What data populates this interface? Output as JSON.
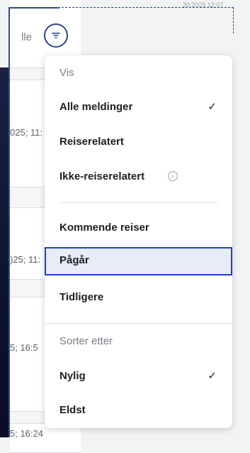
{
  "background": {
    "header_text": "lle",
    "top_timestamp": "20.2025 12:07",
    "rows": [
      {
        "timestamp": "025; 11:"
      },
      {
        "timestamp": ")25; 11:"
      },
      {
        "timestamp": "5; 16:5"
      },
      {
        "timestamp": "5; 16:24"
      }
    ]
  },
  "filter_button": {
    "icon": "filter-icon"
  },
  "menu": {
    "view_section_label": "Vis",
    "view_items": [
      {
        "label": "Alle meldinger",
        "checked": true
      },
      {
        "label": "Reiserelatert",
        "checked": false
      },
      {
        "label": "Ikke-reiserelatert",
        "checked": false,
        "info": "i"
      }
    ],
    "status_items": [
      {
        "label": "Kommende reiser"
      },
      {
        "label": "Pågår",
        "selected": true
      },
      {
        "label": "Tidligere"
      }
    ],
    "sort_section_label": "Sorter etter",
    "sort_items": [
      {
        "label": "Nylig",
        "checked": true
      },
      {
        "label": "Eldst",
        "checked": false
      }
    ],
    "check_glyph": "✓"
  },
  "colors": {
    "accent": "#1f3fd1",
    "focus_outline": "#2b4a86",
    "selected_bg": "#e8edf5"
  }
}
